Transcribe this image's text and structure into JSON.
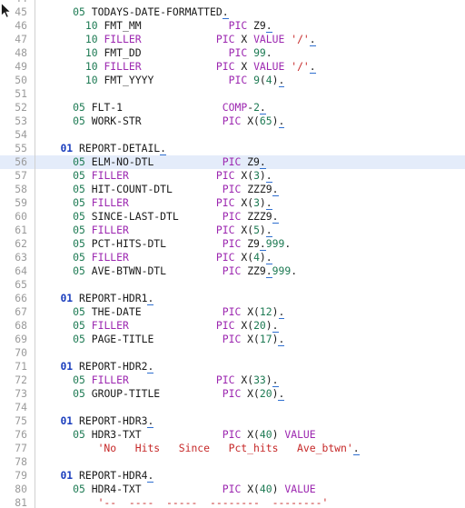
{
  "editor": {
    "language": "COBOL",
    "current_line": 56,
    "first_visible_line": 44,
    "last_visible_line": 81,
    "colors": {
      "background": "#ffffff",
      "gutter_text": "#9a9a9a",
      "gutter_rule": "#d0d0d0",
      "current_line_highlight": "#e4ecfa",
      "level_01": "#1c3fbe",
      "level_number": "#1d7a53",
      "keyword": "#9c27b0",
      "number": "#1d7a53",
      "string": "#c62828",
      "identifier": "#1a1a1a",
      "squiggle": "#2f6fd0"
    },
    "cursor_icon": "mouse-pointer-icon"
  },
  "lines": [
    {
      "n": 44,
      "tokens": []
    },
    {
      "n": 45,
      "tokens": [
        {
          "t": "      ",
          "c": "t-id"
        },
        {
          "t": "05",
          "c": "t-lvl"
        },
        {
          "t": " TODAYS-DATE-FORMATTED",
          "c": "t-id"
        },
        {
          "t": ".",
          "c": "t-dot",
          "sq": true
        }
      ]
    },
    {
      "n": 46,
      "tokens": [
        {
          "t": "        ",
          "c": "t-id"
        },
        {
          "t": "10",
          "c": "t-lvl"
        },
        {
          "t": " FMT_MM",
          "c": "t-id"
        },
        {
          "t": "              ",
          "c": "t-id"
        },
        {
          "t": "PIC",
          "c": "t-kw"
        },
        {
          "t": " Z9",
          "c": "t-id"
        },
        {
          "t": ".",
          "c": "t-dot",
          "sq": true
        }
      ]
    },
    {
      "n": 47,
      "tokens": [
        {
          "t": "        ",
          "c": "t-id"
        },
        {
          "t": "10",
          "c": "t-lvl"
        },
        {
          "t": " ",
          "c": "t-id"
        },
        {
          "t": "FILLER",
          "c": "t-kw"
        },
        {
          "t": "            ",
          "c": "t-id"
        },
        {
          "t": "PIC",
          "c": "t-kw"
        },
        {
          "t": " X ",
          "c": "t-id"
        },
        {
          "t": "VALUE",
          "c": "t-kw"
        },
        {
          "t": " ",
          "c": "t-id"
        },
        {
          "t": "'/'",
          "c": "t-str"
        },
        {
          "t": ".",
          "c": "t-dot",
          "sq": true
        }
      ]
    },
    {
      "n": 48,
      "tokens": [
        {
          "t": "        ",
          "c": "t-id"
        },
        {
          "t": "10",
          "c": "t-lvl"
        },
        {
          "t": " FMT_DD",
          "c": "t-id"
        },
        {
          "t": "              ",
          "c": "t-id"
        },
        {
          "t": "PIC",
          "c": "t-kw"
        },
        {
          "t": " ",
          "c": "t-id"
        },
        {
          "t": "99",
          "c": "t-num"
        },
        {
          "t": ".",
          "c": "t-dot"
        }
      ]
    },
    {
      "n": 49,
      "tokens": [
        {
          "t": "        ",
          "c": "t-id"
        },
        {
          "t": "10",
          "c": "t-lvl"
        },
        {
          "t": " ",
          "c": "t-id"
        },
        {
          "t": "FILLER",
          "c": "t-kw"
        },
        {
          "t": "            ",
          "c": "t-id"
        },
        {
          "t": "PIC",
          "c": "t-kw"
        },
        {
          "t": " X ",
          "c": "t-id"
        },
        {
          "t": "VALUE",
          "c": "t-kw"
        },
        {
          "t": " ",
          "c": "t-id"
        },
        {
          "t": "'/'",
          "c": "t-str"
        },
        {
          "t": ".",
          "c": "t-dot",
          "sq": true
        }
      ]
    },
    {
      "n": 50,
      "tokens": [
        {
          "t": "        ",
          "c": "t-id"
        },
        {
          "t": "10",
          "c": "t-lvl"
        },
        {
          "t": " FMT_YYYY",
          "c": "t-id"
        },
        {
          "t": "            ",
          "c": "t-id"
        },
        {
          "t": "PIC",
          "c": "t-kw"
        },
        {
          "t": " ",
          "c": "t-id"
        },
        {
          "t": "9",
          "c": "t-num"
        },
        {
          "t": "(",
          "c": "t-id"
        },
        {
          "t": "4",
          "c": "t-num"
        },
        {
          "t": ")",
          "c": "t-id"
        },
        {
          "t": ".",
          "c": "t-dot",
          "sq": true
        }
      ]
    },
    {
      "n": 51,
      "tokens": []
    },
    {
      "n": 52,
      "tokens": [
        {
          "t": "      ",
          "c": "t-id"
        },
        {
          "t": "05",
          "c": "t-lvl"
        },
        {
          "t": " FLT-1",
          "c": "t-id"
        },
        {
          "t": "                ",
          "c": "t-id"
        },
        {
          "t": "COMP",
          "c": "t-kw"
        },
        {
          "t": "-",
          "c": "t-id"
        },
        {
          "t": "2",
          "c": "t-num"
        },
        {
          "t": ".",
          "c": "t-dot",
          "sq": true
        }
      ]
    },
    {
      "n": 53,
      "tokens": [
        {
          "t": "      ",
          "c": "t-id"
        },
        {
          "t": "05",
          "c": "t-lvl"
        },
        {
          "t": " WORK-STR",
          "c": "t-id"
        },
        {
          "t": "             ",
          "c": "t-id"
        },
        {
          "t": "PIC",
          "c": "t-kw"
        },
        {
          "t": " X(",
          "c": "t-id"
        },
        {
          "t": "65",
          "c": "t-num"
        },
        {
          "t": ")",
          "c": "t-id"
        },
        {
          "t": ".",
          "c": "t-dot",
          "sq": true
        }
      ]
    },
    {
      "n": 54,
      "tokens": []
    },
    {
      "n": 55,
      "tokens": [
        {
          "t": "    ",
          "c": "t-id"
        },
        {
          "t": "01",
          "c": "t-lvl01"
        },
        {
          "t": " REPORT-DETAIL",
          "c": "t-id"
        },
        {
          "t": ".",
          "c": "t-dot",
          "sq": true
        }
      ]
    },
    {
      "n": 56,
      "tokens": [
        {
          "t": "      ",
          "c": "t-id"
        },
        {
          "t": "05",
          "c": "t-lvl"
        },
        {
          "t": " ELM-NO-DTL",
          "c": "t-id"
        },
        {
          "t": "           ",
          "c": "t-id"
        },
        {
          "t": "PIC",
          "c": "t-kw"
        },
        {
          "t": " Z9",
          "c": "t-id"
        },
        {
          "t": ".",
          "c": "t-dot",
          "sq": true
        }
      ]
    },
    {
      "n": 57,
      "tokens": [
        {
          "t": "      ",
          "c": "t-id"
        },
        {
          "t": "05",
          "c": "t-lvl"
        },
        {
          "t": " ",
          "c": "t-id"
        },
        {
          "t": "FILLER",
          "c": "t-kw"
        },
        {
          "t": "              ",
          "c": "t-id"
        },
        {
          "t": "PIC",
          "c": "t-kw"
        },
        {
          "t": " X(",
          "c": "t-id"
        },
        {
          "t": "3",
          "c": "t-num"
        },
        {
          "t": ")",
          "c": "t-id"
        },
        {
          "t": ".",
          "c": "t-dot",
          "sq": true
        }
      ]
    },
    {
      "n": 58,
      "tokens": [
        {
          "t": "      ",
          "c": "t-id"
        },
        {
          "t": "05",
          "c": "t-lvl"
        },
        {
          "t": " HIT-COUNT-DTL",
          "c": "t-id"
        },
        {
          "t": "        ",
          "c": "t-id"
        },
        {
          "t": "PIC",
          "c": "t-kw"
        },
        {
          "t": " ZZZ9",
          "c": "t-id"
        },
        {
          "t": ".",
          "c": "t-dot",
          "sq": true
        }
      ]
    },
    {
      "n": 59,
      "tokens": [
        {
          "t": "      ",
          "c": "t-id"
        },
        {
          "t": "05",
          "c": "t-lvl"
        },
        {
          "t": " ",
          "c": "t-id"
        },
        {
          "t": "FILLER",
          "c": "t-kw"
        },
        {
          "t": "              ",
          "c": "t-id"
        },
        {
          "t": "PIC",
          "c": "t-kw"
        },
        {
          "t": " X(",
          "c": "t-id"
        },
        {
          "t": "3",
          "c": "t-num"
        },
        {
          "t": ")",
          "c": "t-id"
        },
        {
          "t": ".",
          "c": "t-dot",
          "sq": true
        }
      ]
    },
    {
      "n": 60,
      "tokens": [
        {
          "t": "      ",
          "c": "t-id"
        },
        {
          "t": "05",
          "c": "t-lvl"
        },
        {
          "t": " SINCE-LAST-DTL",
          "c": "t-id"
        },
        {
          "t": "       ",
          "c": "t-id"
        },
        {
          "t": "PIC",
          "c": "t-kw"
        },
        {
          "t": " ZZZ9",
          "c": "t-id"
        },
        {
          "t": ".",
          "c": "t-dot",
          "sq": true
        }
      ]
    },
    {
      "n": 61,
      "tokens": [
        {
          "t": "      ",
          "c": "t-id"
        },
        {
          "t": "05",
          "c": "t-lvl"
        },
        {
          "t": " ",
          "c": "t-id"
        },
        {
          "t": "FILLER",
          "c": "t-kw"
        },
        {
          "t": "              ",
          "c": "t-id"
        },
        {
          "t": "PIC",
          "c": "t-kw"
        },
        {
          "t": " X(",
          "c": "t-id"
        },
        {
          "t": "5",
          "c": "t-num"
        },
        {
          "t": ")",
          "c": "t-id"
        },
        {
          "t": ".",
          "c": "t-dot",
          "sq": true
        }
      ]
    },
    {
      "n": 62,
      "tokens": [
        {
          "t": "      ",
          "c": "t-id"
        },
        {
          "t": "05",
          "c": "t-lvl"
        },
        {
          "t": " PCT-HITS-DTL",
          "c": "t-id"
        },
        {
          "t": "         ",
          "c": "t-id"
        },
        {
          "t": "PIC",
          "c": "t-kw"
        },
        {
          "t": " Z9",
          "c": "t-id"
        },
        {
          "t": ".",
          "c": "t-dot",
          "sq": true
        },
        {
          "t": "999",
          "c": "t-num"
        },
        {
          "t": ".",
          "c": "t-dot"
        }
      ]
    },
    {
      "n": 63,
      "tokens": [
        {
          "t": "      ",
          "c": "t-id"
        },
        {
          "t": "05",
          "c": "t-lvl"
        },
        {
          "t": " ",
          "c": "t-id"
        },
        {
          "t": "FILLER",
          "c": "t-kw"
        },
        {
          "t": "              ",
          "c": "t-id"
        },
        {
          "t": "PIC",
          "c": "t-kw"
        },
        {
          "t": " X(",
          "c": "t-id"
        },
        {
          "t": "4",
          "c": "t-num"
        },
        {
          "t": ")",
          "c": "t-id"
        },
        {
          "t": ".",
          "c": "t-dot",
          "sq": true
        }
      ]
    },
    {
      "n": 64,
      "tokens": [
        {
          "t": "      ",
          "c": "t-id"
        },
        {
          "t": "05",
          "c": "t-lvl"
        },
        {
          "t": " AVE-BTWN-DTL",
          "c": "t-id"
        },
        {
          "t": "         ",
          "c": "t-id"
        },
        {
          "t": "PIC",
          "c": "t-kw"
        },
        {
          "t": " ZZ9",
          "c": "t-id"
        },
        {
          "t": ".",
          "c": "t-dot",
          "sq": true
        },
        {
          "t": "999",
          "c": "t-num"
        },
        {
          "t": ".",
          "c": "t-dot"
        }
      ]
    },
    {
      "n": 65,
      "tokens": []
    },
    {
      "n": 66,
      "tokens": [
        {
          "t": "    ",
          "c": "t-id"
        },
        {
          "t": "01",
          "c": "t-lvl01"
        },
        {
          "t": " REPORT-HDR1",
          "c": "t-id"
        },
        {
          "t": ".",
          "c": "t-dot",
          "sq": true
        }
      ]
    },
    {
      "n": 67,
      "tokens": [
        {
          "t": "      ",
          "c": "t-id"
        },
        {
          "t": "05",
          "c": "t-lvl"
        },
        {
          "t": " THE-DATE",
          "c": "t-id"
        },
        {
          "t": "             ",
          "c": "t-id"
        },
        {
          "t": "PIC",
          "c": "t-kw"
        },
        {
          "t": " X(",
          "c": "t-id"
        },
        {
          "t": "12",
          "c": "t-num"
        },
        {
          "t": ")",
          "c": "t-id"
        },
        {
          "t": ".",
          "c": "t-dot",
          "sq": true
        }
      ]
    },
    {
      "n": 68,
      "tokens": [
        {
          "t": "      ",
          "c": "t-id"
        },
        {
          "t": "05",
          "c": "t-lvl"
        },
        {
          "t": " ",
          "c": "t-id"
        },
        {
          "t": "FILLER",
          "c": "t-kw"
        },
        {
          "t": "              ",
          "c": "t-id"
        },
        {
          "t": "PIC",
          "c": "t-kw"
        },
        {
          "t": " X(",
          "c": "t-id"
        },
        {
          "t": "20",
          "c": "t-num"
        },
        {
          "t": ")",
          "c": "t-id"
        },
        {
          "t": ".",
          "c": "t-dot",
          "sq": true
        }
      ]
    },
    {
      "n": 69,
      "tokens": [
        {
          "t": "      ",
          "c": "t-id"
        },
        {
          "t": "05",
          "c": "t-lvl"
        },
        {
          "t": " PAGE-TITLE",
          "c": "t-id"
        },
        {
          "t": "           ",
          "c": "t-id"
        },
        {
          "t": "PIC",
          "c": "t-kw"
        },
        {
          "t": " X(",
          "c": "t-id"
        },
        {
          "t": "17",
          "c": "t-num"
        },
        {
          "t": ")",
          "c": "t-id"
        },
        {
          "t": ".",
          "c": "t-dot",
          "sq": true
        }
      ]
    },
    {
      "n": 70,
      "tokens": []
    },
    {
      "n": 71,
      "tokens": [
        {
          "t": "    ",
          "c": "t-id"
        },
        {
          "t": "01",
          "c": "t-lvl01"
        },
        {
          "t": " REPORT-HDR2",
          "c": "t-id"
        },
        {
          "t": ".",
          "c": "t-dot",
          "sq": true
        }
      ]
    },
    {
      "n": 72,
      "tokens": [
        {
          "t": "      ",
          "c": "t-id"
        },
        {
          "t": "05",
          "c": "t-lvl"
        },
        {
          "t": " ",
          "c": "t-id"
        },
        {
          "t": "FILLER",
          "c": "t-kw"
        },
        {
          "t": "              ",
          "c": "t-id"
        },
        {
          "t": "PIC",
          "c": "t-kw"
        },
        {
          "t": " X(",
          "c": "t-id"
        },
        {
          "t": "33",
          "c": "t-num"
        },
        {
          "t": ")",
          "c": "t-id"
        },
        {
          "t": ".",
          "c": "t-dot",
          "sq": true
        }
      ]
    },
    {
      "n": 73,
      "tokens": [
        {
          "t": "      ",
          "c": "t-id"
        },
        {
          "t": "05",
          "c": "t-lvl"
        },
        {
          "t": " GROUP-TITLE",
          "c": "t-id"
        },
        {
          "t": "          ",
          "c": "t-id"
        },
        {
          "t": "PIC",
          "c": "t-kw"
        },
        {
          "t": " X(",
          "c": "t-id"
        },
        {
          "t": "20",
          "c": "t-num"
        },
        {
          "t": ")",
          "c": "t-id"
        },
        {
          "t": ".",
          "c": "t-dot",
          "sq": true
        }
      ]
    },
    {
      "n": 74,
      "tokens": []
    },
    {
      "n": 75,
      "tokens": [
        {
          "t": "    ",
          "c": "t-id"
        },
        {
          "t": "01",
          "c": "t-lvl01"
        },
        {
          "t": " REPORT-HDR3",
          "c": "t-id"
        },
        {
          "t": ".",
          "c": "t-dot",
          "sq": true
        }
      ]
    },
    {
      "n": 76,
      "tokens": [
        {
          "t": "      ",
          "c": "t-id"
        },
        {
          "t": "05",
          "c": "t-lvl"
        },
        {
          "t": " HDR3-TXT",
          "c": "t-id"
        },
        {
          "t": "             ",
          "c": "t-id"
        },
        {
          "t": "PIC",
          "c": "t-kw"
        },
        {
          "t": " X(",
          "c": "t-id"
        },
        {
          "t": "40",
          "c": "t-num"
        },
        {
          "t": ") ",
          "c": "t-id"
        },
        {
          "t": "VALUE",
          "c": "t-kw"
        }
      ]
    },
    {
      "n": 77,
      "tokens": [
        {
          "t": "          ",
          "c": "t-id"
        },
        {
          "t": "'No   Hits   Since   Pct_hits   Ave_btwn'",
          "c": "t-str"
        },
        {
          "t": ".",
          "c": "t-dot",
          "sq": true
        }
      ]
    },
    {
      "n": 78,
      "tokens": []
    },
    {
      "n": 79,
      "tokens": [
        {
          "t": "    ",
          "c": "t-id"
        },
        {
          "t": "01",
          "c": "t-lvl01"
        },
        {
          "t": " REPORT-HDR4",
          "c": "t-id"
        },
        {
          "t": ".",
          "c": "t-dot",
          "sq": true
        }
      ]
    },
    {
      "n": 80,
      "tokens": [
        {
          "t": "      ",
          "c": "t-id"
        },
        {
          "t": "05",
          "c": "t-lvl"
        },
        {
          "t": " HDR4-TXT",
          "c": "t-id"
        },
        {
          "t": "             ",
          "c": "t-id"
        },
        {
          "t": "PIC",
          "c": "t-kw"
        },
        {
          "t": " X(",
          "c": "t-id"
        },
        {
          "t": "40",
          "c": "t-num"
        },
        {
          "t": ") ",
          "c": "t-id"
        },
        {
          "t": "VALUE",
          "c": "t-kw"
        }
      ]
    },
    {
      "n": 81,
      "tokens": [
        {
          "t": "          ",
          "c": "t-id"
        },
        {
          "t": "'--  ----  -----  --------  --------'",
          "c": "t-str"
        }
      ]
    }
  ]
}
